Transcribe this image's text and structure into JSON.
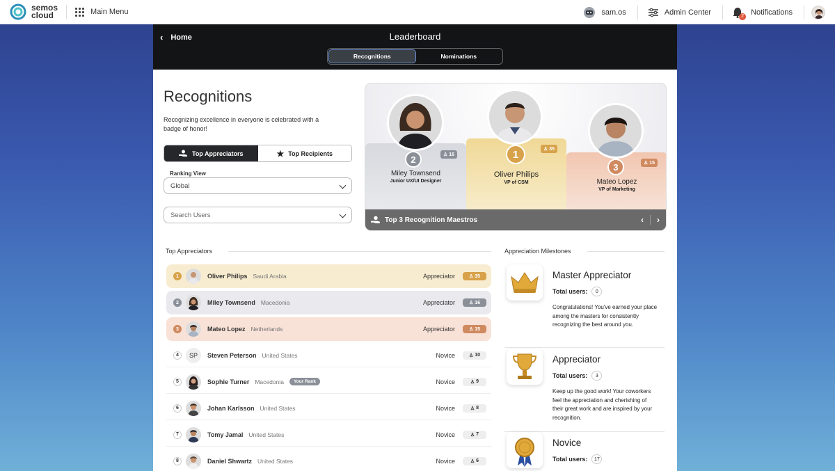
{
  "topbar": {
    "brand": [
      "semos",
      "cloud"
    ],
    "main_menu": "Main Menu",
    "user": "sam.os",
    "admin": "Admin Center",
    "notif_count": "2",
    "notifications": "Notifications"
  },
  "header": {
    "back": "Home",
    "title": "Leaderboard",
    "tabs": [
      "Recognitions",
      "Nominations"
    ]
  },
  "page": {
    "title": "Recognitions",
    "subtitle": "Recognizing excellence in everyone is celebrated with a badge of honor!",
    "toggle": [
      "Top Appreciators",
      "Top Recipients"
    ],
    "ranking_label": "Ranking View",
    "ranking_value": "Global",
    "search_placeholder": "Search Users"
  },
  "podium": {
    "footer": "Top 3 Recognition Maestros",
    "places": [
      {
        "rank": "2",
        "name": "Miley Townsend",
        "role": "Junior UX/UI Designer",
        "count": "16"
      },
      {
        "rank": "1",
        "name": "Oliver Philips",
        "role": "VP of CSM",
        "count": "35"
      },
      {
        "rank": "3",
        "name": "Mateo Lopez",
        "role": "VP of Marketing",
        "count": "15"
      }
    ]
  },
  "list": {
    "title": "Top Appreciators",
    "your_rank": "Your Rank",
    "rows": [
      {
        "rank": "1",
        "name": "Oliver Philips",
        "country": "Saudi Arabia",
        "level": "Appreciator",
        "count": "35"
      },
      {
        "rank": "2",
        "name": "Miley Townsend",
        "country": "Macedonia",
        "level": "Appreciator",
        "count": "16"
      },
      {
        "rank": "3",
        "name": "Mateo Lopez",
        "country": "Netherlands",
        "level": "Appreciator",
        "count": "15"
      },
      {
        "rank": "4",
        "initials": "SP",
        "name": "Steven Peterson",
        "country": "United States",
        "level": "Novice",
        "count": "10"
      },
      {
        "rank": "5",
        "name": "Sophie Turner",
        "country": "Macedonia",
        "level": "Novice",
        "count": "9"
      },
      {
        "rank": "6",
        "name": "Johan Karlsson",
        "country": "United States",
        "level": "Novice",
        "count": "8"
      },
      {
        "rank": "7",
        "name": "Tomy Jamal",
        "country": "United States",
        "level": "Novice",
        "count": "7"
      },
      {
        "rank": "8",
        "name": "Daniel Shwartz",
        "country": "United States",
        "level": "Novice",
        "count": "6"
      }
    ]
  },
  "milestones": {
    "title": "Appreciation Milestones",
    "total_label": "Total users:",
    "items": [
      {
        "name": "Master Appreciator",
        "total": "0",
        "desc": "Congratulations! You've earned your place among the masters for consistently recognizing the best around you."
      },
      {
        "name": "Appreciator",
        "total": "3",
        "desc": "Keep up the good work! Your coworkers feel the appreciation and cherishing of their great work and are inspired by your recognition."
      },
      {
        "name": "Novice",
        "total": "17",
        "desc": ""
      }
    ]
  },
  "colors": {
    "gold": "#d8a24a",
    "silver": "#8a8f98",
    "bronze": "#d08a60",
    "accent": "#6a8ecf"
  }
}
